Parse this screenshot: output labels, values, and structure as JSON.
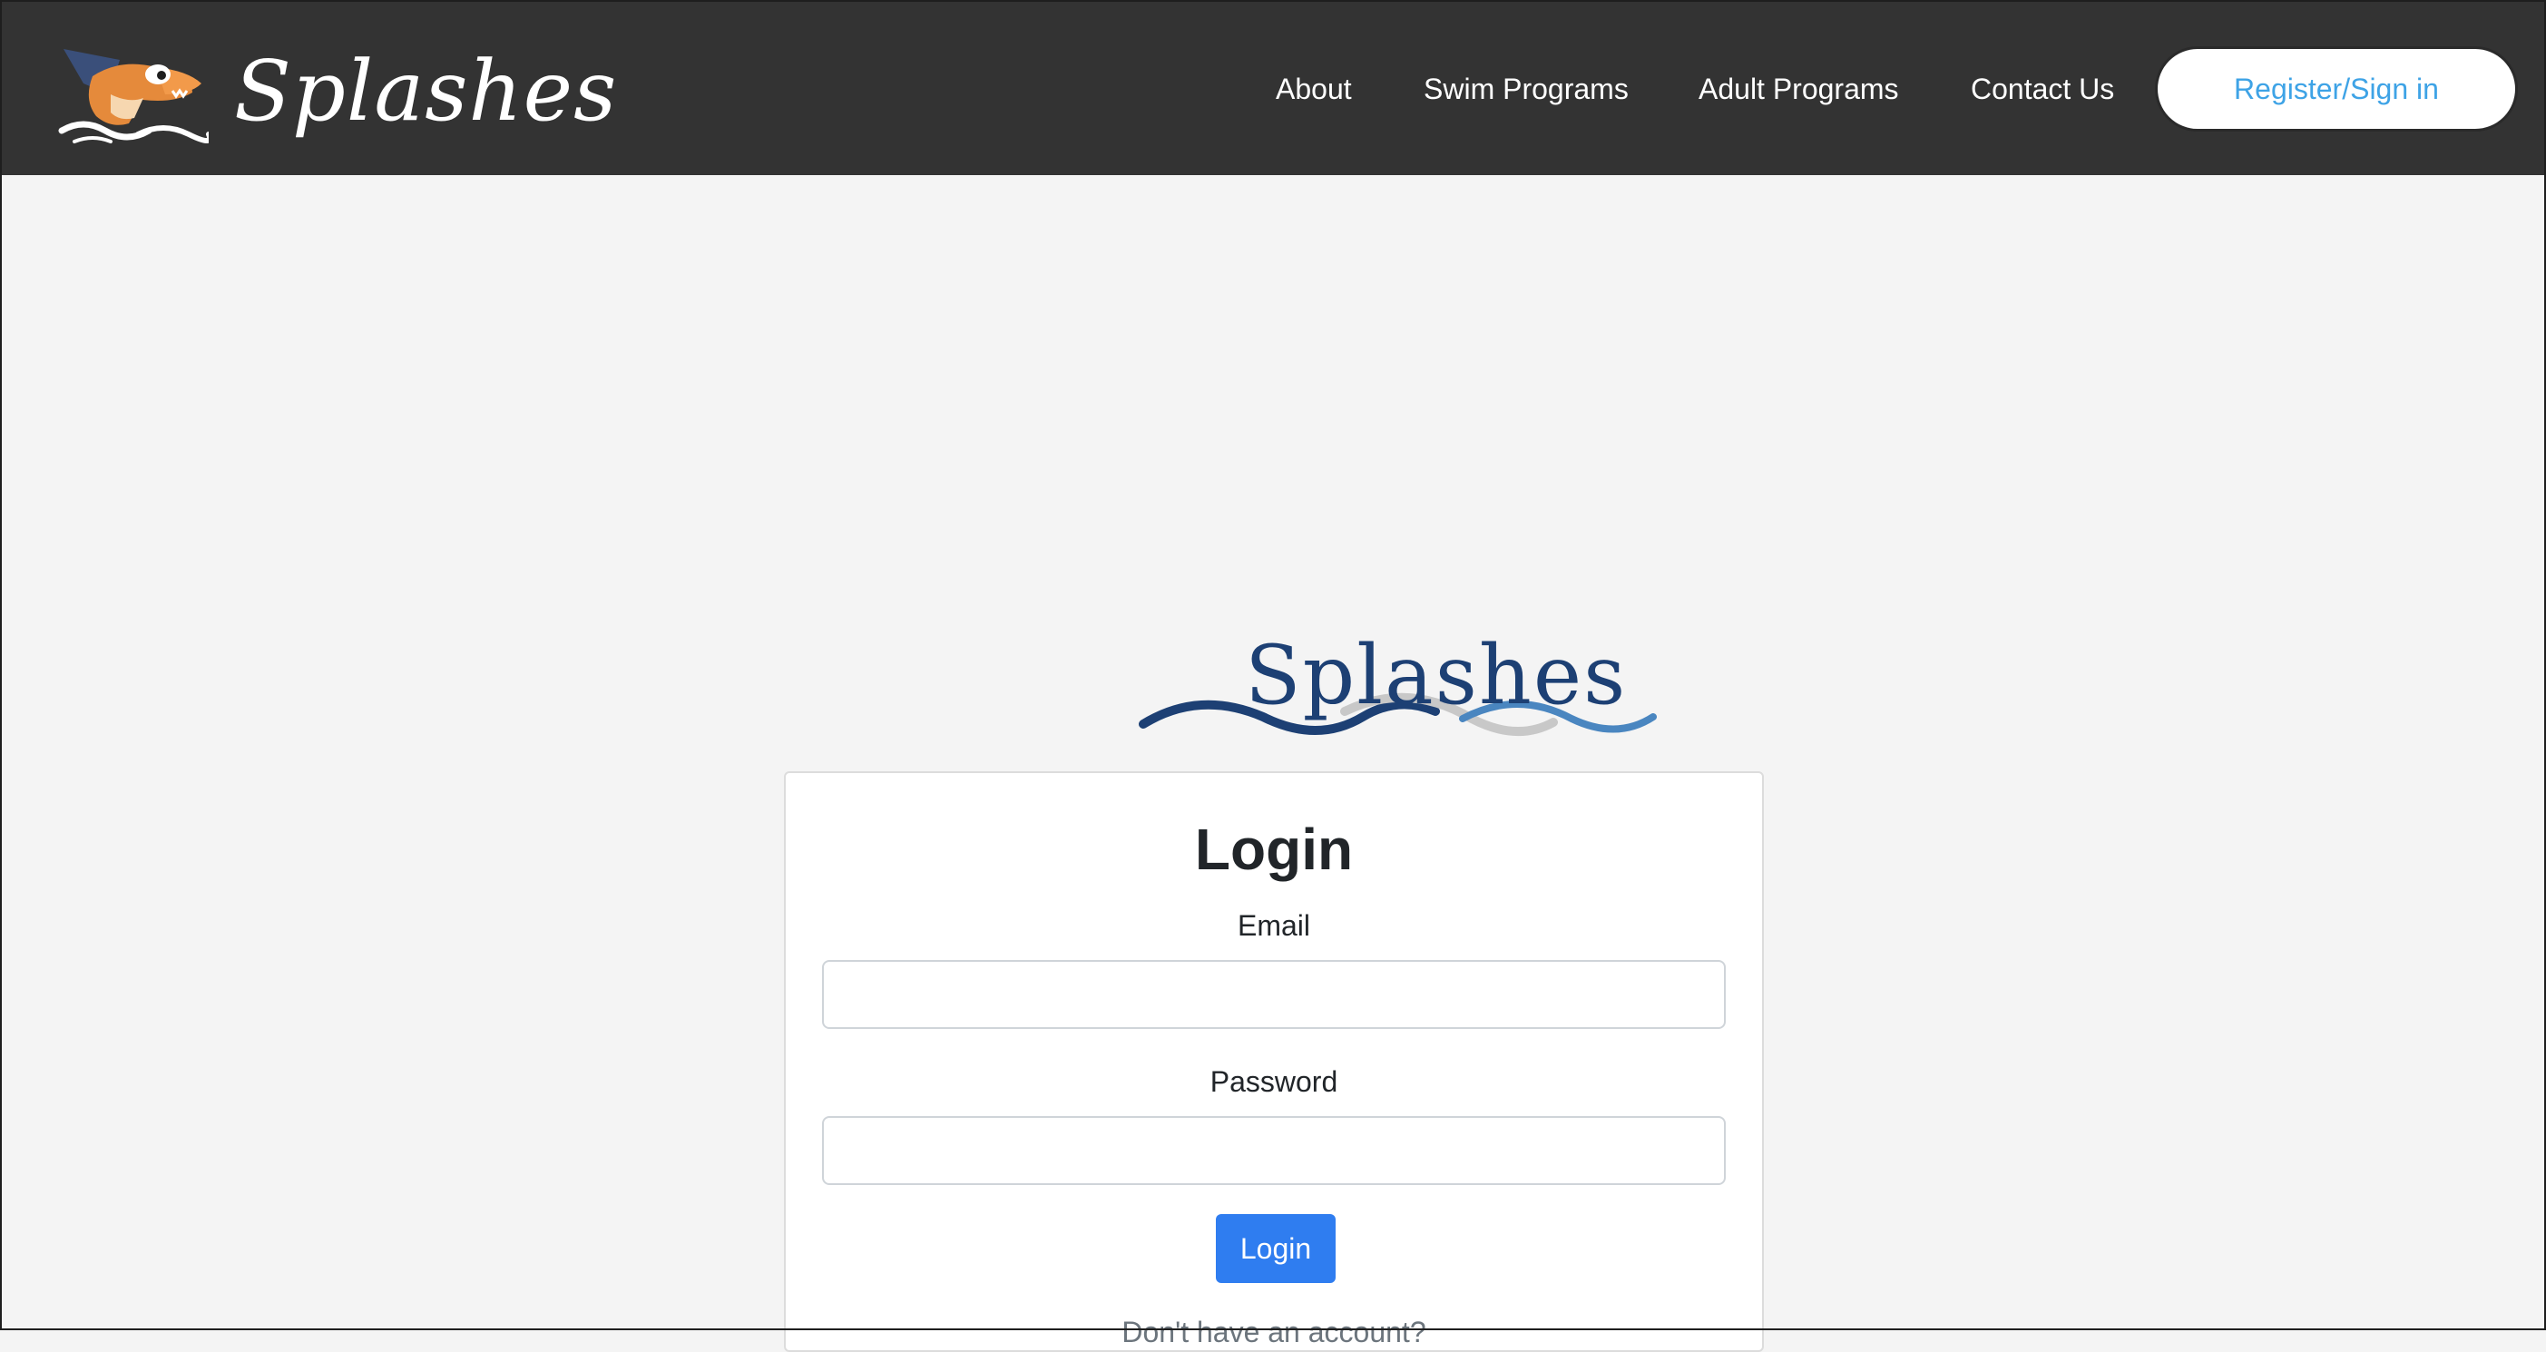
{
  "navbar": {
    "brand_name": "Splashes",
    "links": [
      {
        "label": "About"
      },
      {
        "label": "Swim Programs"
      },
      {
        "label": "Adult Programs"
      },
      {
        "label": "Contact Us"
      }
    ],
    "register_label": "Register/Sign in"
  },
  "main": {
    "logo_text": "Splashes",
    "login": {
      "title": "Login",
      "email_label": "Email",
      "email_value": "",
      "password_label": "Password",
      "password_value": "",
      "submit_label": "Login",
      "signup_prompt": "Don't have an account?"
    }
  },
  "colors": {
    "navbar_bg": "#333333",
    "page_bg": "#f4f4f4",
    "accent_link": "#3ea3e6",
    "primary_button": "#2f7df0",
    "logo_navy": "#1d4074"
  },
  "icons": [
    "mascot-logo-icon",
    "wave-logo-icon"
  ]
}
